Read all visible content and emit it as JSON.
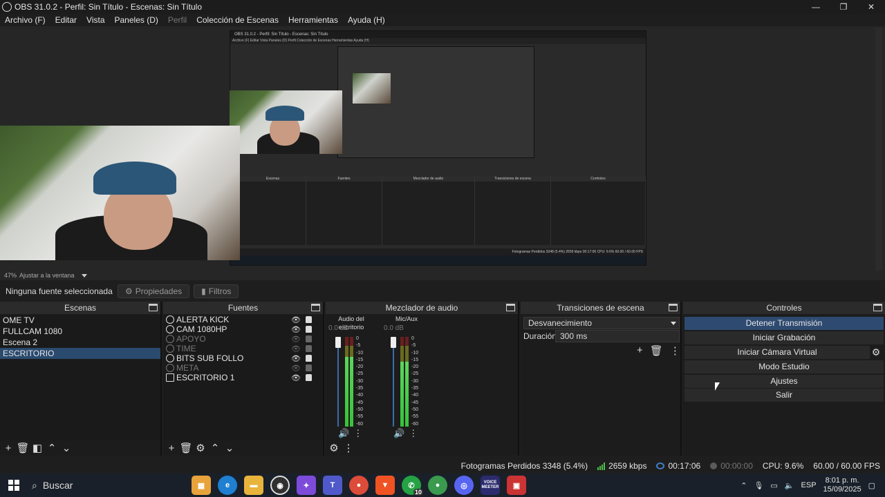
{
  "window": {
    "title": "OBS 31.0.2 - Perfil: Sin Título - Escenas: Sin Título",
    "minimize": "—",
    "maximize": "❐",
    "close": "✕"
  },
  "menu": [
    "Archivo (F)",
    "Editar",
    "Vista",
    "Paneles (D)",
    "Perfil",
    "Colección de Escenas",
    "Herramientas",
    "Ayuda (H)"
  ],
  "preview": {
    "zoom": "47%",
    "zoom_label": "Ajustar a la ventana",
    "mini": {
      "title": "OBS 31.0.2 - Perfil: Sin Título - Escenas: Sin Título",
      "menu": "Archivo (F)   Editar   Vista   Paneles (D)   Perfil   Colección de Escenas   Herramientas   Ayuda (H)",
      "panels": [
        "Escenas",
        "Fuentes",
        "Mezclador de audio",
        "Transiciones de escena",
        "Controles"
      ],
      "status": "Fotogramas Perdidos 3348 (5.4%)   2659 kbps   00:17:06   CPU: 9.6%   60.00 / 60.00 FPS"
    }
  },
  "source_toolbar": {
    "no_selection": "Ninguna fuente seleccionada",
    "properties": "Propiedades",
    "filters": "Filtros"
  },
  "scenes": {
    "title": "Escenas",
    "items": [
      "OME TV",
      "FULLCAM 1080",
      "Escena 2",
      "ESCRITORIO"
    ],
    "selected": "ESCRITORIO"
  },
  "sources": {
    "title": "Fuentes",
    "items": [
      {
        "name": "ALERTA KICK",
        "visible": true
      },
      {
        "name": "CAM 1080HP",
        "visible": true
      },
      {
        "name": "APOYO",
        "visible": false
      },
      {
        "name": "TIME",
        "visible": false
      },
      {
        "name": "BITS SUB FOLLO",
        "visible": true
      },
      {
        "name": "META",
        "visible": false
      },
      {
        "name": "ESCRITORIO 1",
        "visible": true
      }
    ]
  },
  "mixer": {
    "title": "Mezclador de audio",
    "channels": [
      {
        "name": "Audio del escritorio",
        "db": "0.0 dB",
        "level": 0.78
      },
      {
        "name": "Mic/Aux",
        "db": "0.0 dB",
        "level": 0.72
      }
    ],
    "scale": [
      "0",
      "-5",
      "-10",
      "-15",
      "-20",
      "-25",
      "-30",
      "-35",
      "-40",
      "-45",
      "-50",
      "-55",
      "-60"
    ]
  },
  "transitions": {
    "title": "Transiciones de escena",
    "selected": "Desvanecimiento",
    "duration_label": "Duración",
    "duration": "300 ms"
  },
  "controls": {
    "title": "Controles",
    "stop_stream": "Detener Transmisión",
    "start_recording": "Iniciar Grabación",
    "start_virtual_cam": "Iniciar Cámara Virtual",
    "studio_mode": "Modo Estudio",
    "settings": "Ajustes",
    "exit": "Salir"
  },
  "status": {
    "dropped": "Fotogramas Perdidos 3348 (5.4%)",
    "bitrate": "2659 kbps",
    "stream_time": "00:17:06",
    "rec_time": "00:00:00",
    "cpu": "CPU: 9.6%",
    "fps": "60.00 / 60.00 FPS"
  },
  "taskbar": {
    "search": "Buscar",
    "lang": "ESP",
    "time": "8:01 p. m.",
    "date": "15/09/2025",
    "whatsapp_badge": "10",
    "voicemeeter": "VOICE MEETER"
  },
  "colors": {
    "accent": "#2e4a70",
    "selection": "#2a4a6e",
    "meter_green": "#4cc24c"
  }
}
